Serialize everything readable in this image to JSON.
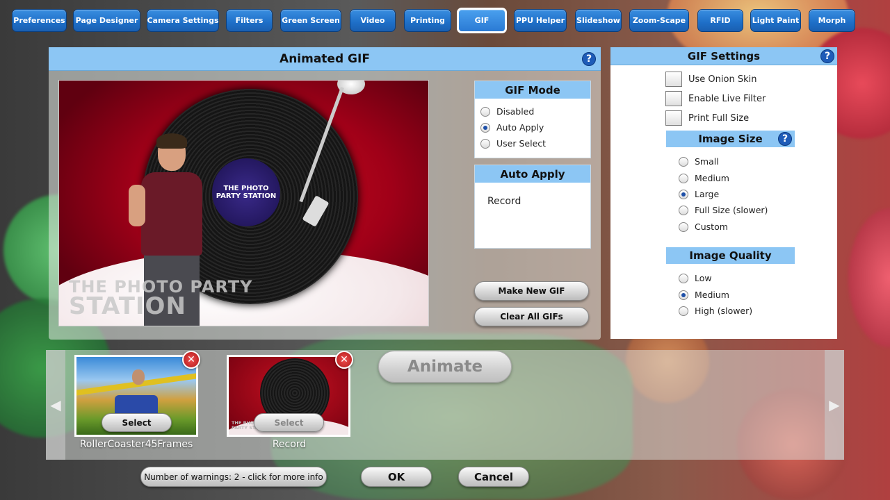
{
  "tabs": [
    {
      "label": "Preferences"
    },
    {
      "label": "Page Designer"
    },
    {
      "label": "Camera Settings"
    },
    {
      "label": "Filters"
    },
    {
      "label": "Green Screen"
    },
    {
      "label": "Video"
    },
    {
      "label": "Printing"
    },
    {
      "label": "GIF",
      "active": true
    },
    {
      "label": "PPU Helper"
    },
    {
      "label": "Slideshow"
    },
    {
      "label": "Zoom-Scape"
    },
    {
      "label": "RFID"
    },
    {
      "label": "Light Paint"
    },
    {
      "label": "Morph"
    }
  ],
  "main": {
    "title": "Animated GIF",
    "help": "?",
    "preview": {
      "vinyl_label": "THE PHOTO PARTY STATION",
      "watermark_line1": "THE PHOTO PARTY",
      "watermark_line2": "STATION"
    },
    "gif_mode": {
      "title": "GIF Mode",
      "options": [
        {
          "label": "Disabled",
          "checked": false
        },
        {
          "label": "Auto Apply",
          "checked": true
        },
        {
          "label": "User Select",
          "checked": false
        }
      ]
    },
    "auto_apply": {
      "title": "Auto Apply",
      "value": "Record"
    },
    "make_new_gif": "Make New GIF",
    "clear_all_gifs": "Clear All GIFs"
  },
  "settings": {
    "title": "GIF Settings",
    "help": "?",
    "checkboxes": [
      {
        "label": "Use Onion Skin",
        "checked": false
      },
      {
        "label": "Enable Live Filter",
        "checked": false
      },
      {
        "label": "Print Full Size",
        "checked": false
      }
    ],
    "image_size": {
      "title": "Image Size",
      "help": "?",
      "options": [
        {
          "label": "Small",
          "checked": false
        },
        {
          "label": "Medium",
          "checked": false
        },
        {
          "label": "Large",
          "checked": true
        },
        {
          "label": "Full Size (slower)",
          "checked": false
        },
        {
          "label": "Custom",
          "checked": false
        }
      ]
    },
    "image_quality": {
      "title": "Image Quality",
      "options": [
        {
          "label": "Low",
          "checked": false
        },
        {
          "label": "Medium",
          "checked": true
        },
        {
          "label": "High (slower)",
          "checked": false
        }
      ]
    }
  },
  "strip": {
    "prev": "◀",
    "next": "▶",
    "items": [
      {
        "name": "RollerCoaster45Frames",
        "select": "Select",
        "close": "✕"
      },
      {
        "name": "Record",
        "select": "Select",
        "close": "✕",
        "thumb_watermark": "THE PHOTO PARTY STATION"
      }
    ],
    "animate": "Animate"
  },
  "footer": {
    "warnings": "Number of warnings: 2 - click for more info",
    "ok": "OK",
    "cancel": "Cancel"
  }
}
